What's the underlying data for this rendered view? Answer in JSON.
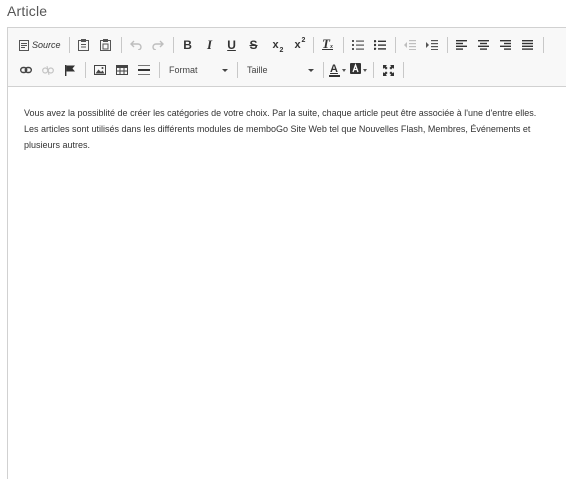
{
  "field": {
    "label": "Article"
  },
  "toolbar": {
    "source_label": "Source",
    "format_label": "Format",
    "size_label": "Taille",
    "font_color_letter": "A"
  },
  "content": {
    "text": "Vous avez la possiblité de créer les catégories de votre choix. Par la suite, chaque article peut être associée à l'une d'entre elles. Les articles sont utilisés dans les différents modules de memboGo Site Web tel que Nouvelles Flash, Membres, Événements et plusieurs autres."
  },
  "icons": {
    "source": "source-icon",
    "paste_text": "paste-text-icon",
    "paste_word": "paste-word-icon",
    "undo": "undo-icon",
    "redo": "redo-icon",
    "bold": "bold-icon",
    "italic": "italic-icon",
    "underline": "underline-icon",
    "strike": "strikethrough-icon",
    "subscript": "subscript-icon",
    "superscript": "superscript-icon",
    "remove_format": "remove-format-icon",
    "numbered_list": "numbered-list-icon",
    "bulleted_list": "bulleted-list-icon",
    "outdent": "outdent-icon",
    "indent": "indent-icon",
    "align_left": "align-left-icon",
    "align_center": "align-center-icon",
    "align_right": "align-right-icon",
    "justify": "justify-icon",
    "link": "link-icon",
    "unlink": "unlink-icon",
    "anchor": "anchor-flag-icon",
    "image": "image-icon",
    "table": "table-icon",
    "horizontal_line": "horizontal-line-icon",
    "text_color": "text-color-icon",
    "bg_color": "background-color-icon",
    "maximize": "maximize-icon"
  },
  "colors": {
    "toolbar_bg": "#f8f8f8",
    "border": "#d1d1d1",
    "text": "#333333",
    "disabled": "#b5b5b5"
  }
}
